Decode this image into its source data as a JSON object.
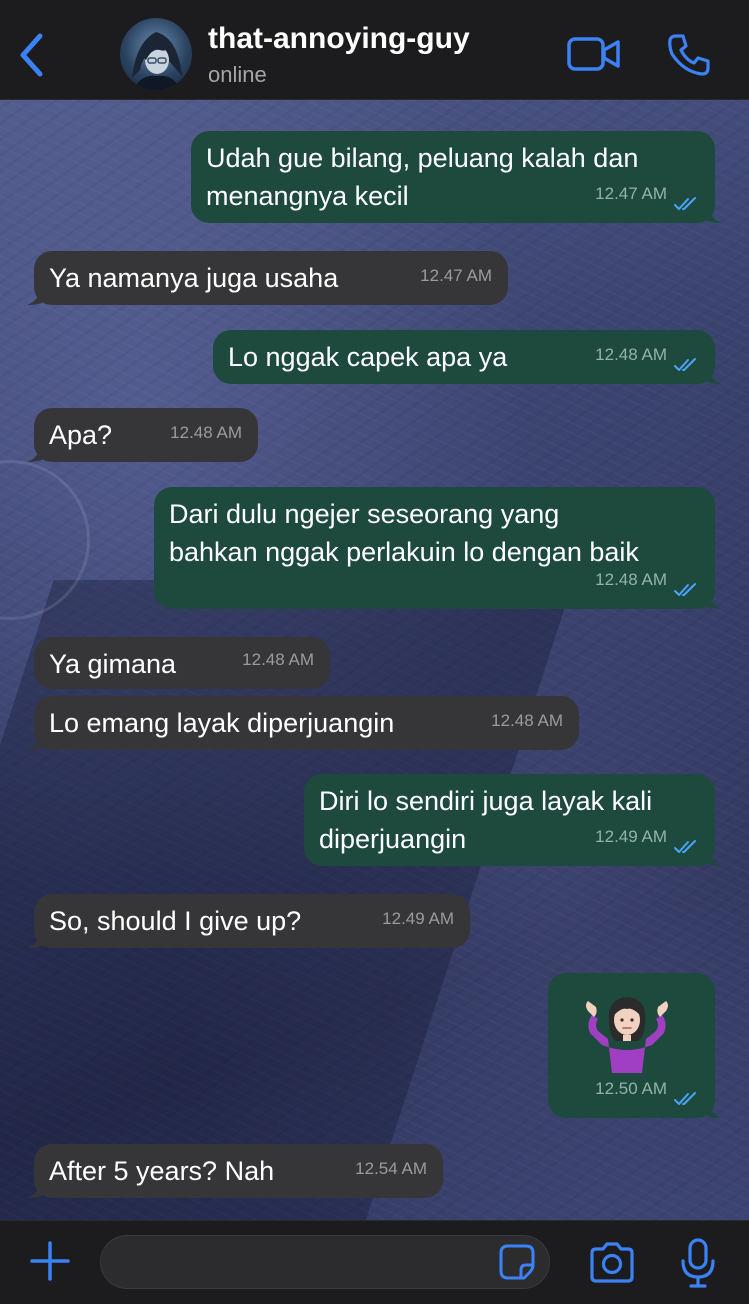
{
  "header": {
    "contact_name": "that-annoying-guy",
    "status": "online",
    "icons": {
      "back": "chevron-left-icon",
      "avatar": "profile-avatar",
      "video": "video-camera-icon",
      "call": "phone-icon"
    }
  },
  "messages": [
    {
      "direction": "out",
      "lines": [
        "Udah gue bilang, peluang kalah dan",
        "menangnya kecil"
      ],
      "time": "12.47 AM",
      "read": true
    },
    {
      "direction": "in",
      "lines": [
        "Ya namanya juga usaha"
      ],
      "time": "12.47 AM"
    },
    {
      "direction": "out",
      "lines": [
        "Lo nggak capek apa ya"
      ],
      "time": "12.48 AM",
      "read": true
    },
    {
      "direction": "in",
      "lines": [
        "Apa?"
      ],
      "time": "12.48 AM"
    },
    {
      "direction": "out",
      "lines": [
        "Dari dulu ngejer seseorang yang",
        "bahkan nggak perlakuin lo dengan baik"
      ],
      "time": "12.48 AM",
      "read": true
    },
    {
      "direction": "in",
      "lines": [
        "Ya gimana"
      ],
      "time": "12.48 AM"
    },
    {
      "direction": "in",
      "lines": [
        "Lo emang layak diperjuangin"
      ],
      "time": "12.48 AM"
    },
    {
      "direction": "out",
      "lines": [
        "Diri lo sendiri juga layak kali",
        "diperjuangin"
      ],
      "time": "12.49 AM",
      "read": true
    },
    {
      "direction": "in",
      "lines": [
        "So, should I give up?"
      ],
      "time": "12.49 AM"
    },
    {
      "direction": "out",
      "emoji": "person-shrugging-emoji",
      "time": "12.50 AM",
      "read": true
    },
    {
      "direction": "in",
      "lines": [
        "After 5 years? Nah"
      ],
      "time": "12.54 AM"
    }
  ],
  "input_bar": {
    "message_value": "",
    "placeholder": "",
    "icons": {
      "plus": "plus-icon",
      "sticker": "sticker-icon",
      "camera": "camera-icon",
      "mic": "microphone-icon"
    }
  },
  "colors": {
    "accent": "#3b82f6",
    "bubble_incoming": "#363638",
    "bubble_outgoing": "#1e4a3e",
    "read_ticks": "#4aa3ff",
    "bar_background": "#1c1c1e"
  }
}
